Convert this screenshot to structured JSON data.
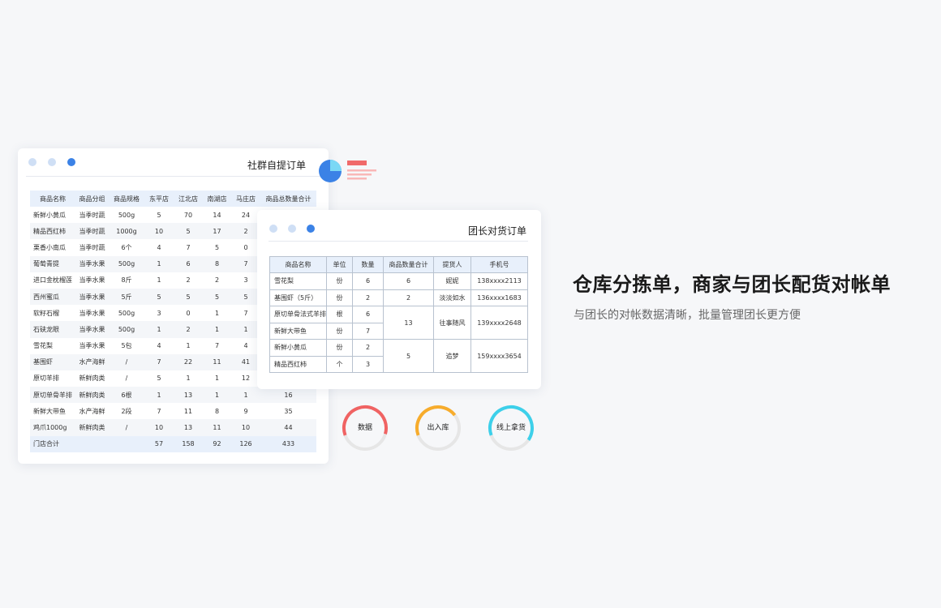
{
  "card1": {
    "title": "社群自提订单",
    "headers": [
      "商品名称",
      "商品分组",
      "商品规格",
      "东平店",
      "江北店",
      "南湖店",
      "马庄店",
      "商品总数量合计"
    ],
    "rows": [
      [
        "新鲜小黄瓜",
        "当季时蔬",
        "500g",
        "5",
        "70",
        "14",
        "24",
        ""
      ],
      [
        "精品西红柿",
        "当季时蔬",
        "1000g",
        "10",
        "5",
        "17",
        "2",
        ""
      ],
      [
        "栗香小南瓜",
        "当季时蔬",
        "6个",
        "4",
        "7",
        "5",
        "0",
        ""
      ],
      [
        "葡萄青提",
        "当季水果",
        "500g",
        "1",
        "6",
        "8",
        "7",
        ""
      ],
      [
        "进口金枕榴莲",
        "当季水果",
        "8斤",
        "1",
        "2",
        "2",
        "3",
        ""
      ],
      [
        "西州蜜瓜",
        "当季水果",
        "5斤",
        "5",
        "5",
        "5",
        "5",
        ""
      ],
      [
        "软籽石榴",
        "当季水果",
        "500g",
        "3",
        "0",
        "1",
        "7",
        ""
      ],
      [
        "石硖龙眼",
        "当季水果",
        "500g",
        "1",
        "2",
        "1",
        "1",
        ""
      ],
      [
        "雪花梨",
        "当季水果",
        "5包",
        "4",
        "1",
        "7",
        "4",
        ""
      ],
      [
        "基围虾",
        "水产海鲜",
        "/",
        "7",
        "22",
        "11",
        "41",
        ""
      ],
      [
        "原切羊排",
        "新鲜肉类",
        "/",
        "5",
        "1",
        "1",
        "12",
        ""
      ],
      [
        "原切单骨羊排",
        "新鲜肉类",
        "6根",
        "1",
        "13",
        "1",
        "1",
        "16"
      ],
      [
        "新鲜大带鱼",
        "水产海鲜",
        "2段",
        "7",
        "11",
        "8",
        "9",
        "35"
      ],
      [
        "鸡爪1000g",
        "新鲜肉类",
        "/",
        "10",
        "13",
        "11",
        "10",
        "44"
      ]
    ],
    "total": [
      "门店合计",
      "",
      "",
      "57",
      "158",
      "92",
      "126",
      "433"
    ]
  },
  "card2": {
    "title": "团长对货订单",
    "headers": [
      "商品名称",
      "单位",
      "数量",
      "商品数量合计",
      "提货人",
      "手机号"
    ],
    "rows": [
      {
        "name": "雪花梨",
        "unit": "份",
        "qty": "6"
      },
      {
        "name": "基围虾（5斤）",
        "unit": "份",
        "qty": "2"
      },
      {
        "name": "原切单骨法式羊排",
        "unit": "根",
        "qty": "6"
      },
      {
        "name": "新鲜大带鱼",
        "unit": "份",
        "qty": "7"
      },
      {
        "name": "新鲜小黄瓜",
        "unit": "份",
        "qty": "2"
      },
      {
        "name": "精品西红柿",
        "unit": "个",
        "qty": "3"
      }
    ],
    "groups": [
      {
        "total": "6",
        "person": "妮妮",
        "phone": "138xxxx2113"
      },
      {
        "total": "2",
        "person": "淡淡如水",
        "phone": "136xxxx1683"
      },
      {
        "total": "13",
        "person": "往事随风",
        "phone": "139xxxx2648"
      },
      {
        "total": "5",
        "person": "追梦",
        "phone": "159xxxx3654"
      }
    ]
  },
  "rings": [
    {
      "label": "数据",
      "color": "#f06363",
      "progress": 0.6
    },
    {
      "label": "出入库",
      "color": "#f7ac2c",
      "progress": 0.45
    },
    {
      "label": "线上拿货",
      "color": "#3dd0ea",
      "progress": 0.65
    }
  ],
  "colors": {
    "accent": "#3b82e6",
    "pie_light": "#7ad8f5",
    "bar_red": "#f06a6a",
    "bar_pink": "#f9b7b7",
    "ring_track": "#e6e6e6"
  },
  "headline": "仓库分拣单，商家与团长配货对帐单",
  "subline": "与团长的对帐数据清晰，批量管理团长更方便"
}
